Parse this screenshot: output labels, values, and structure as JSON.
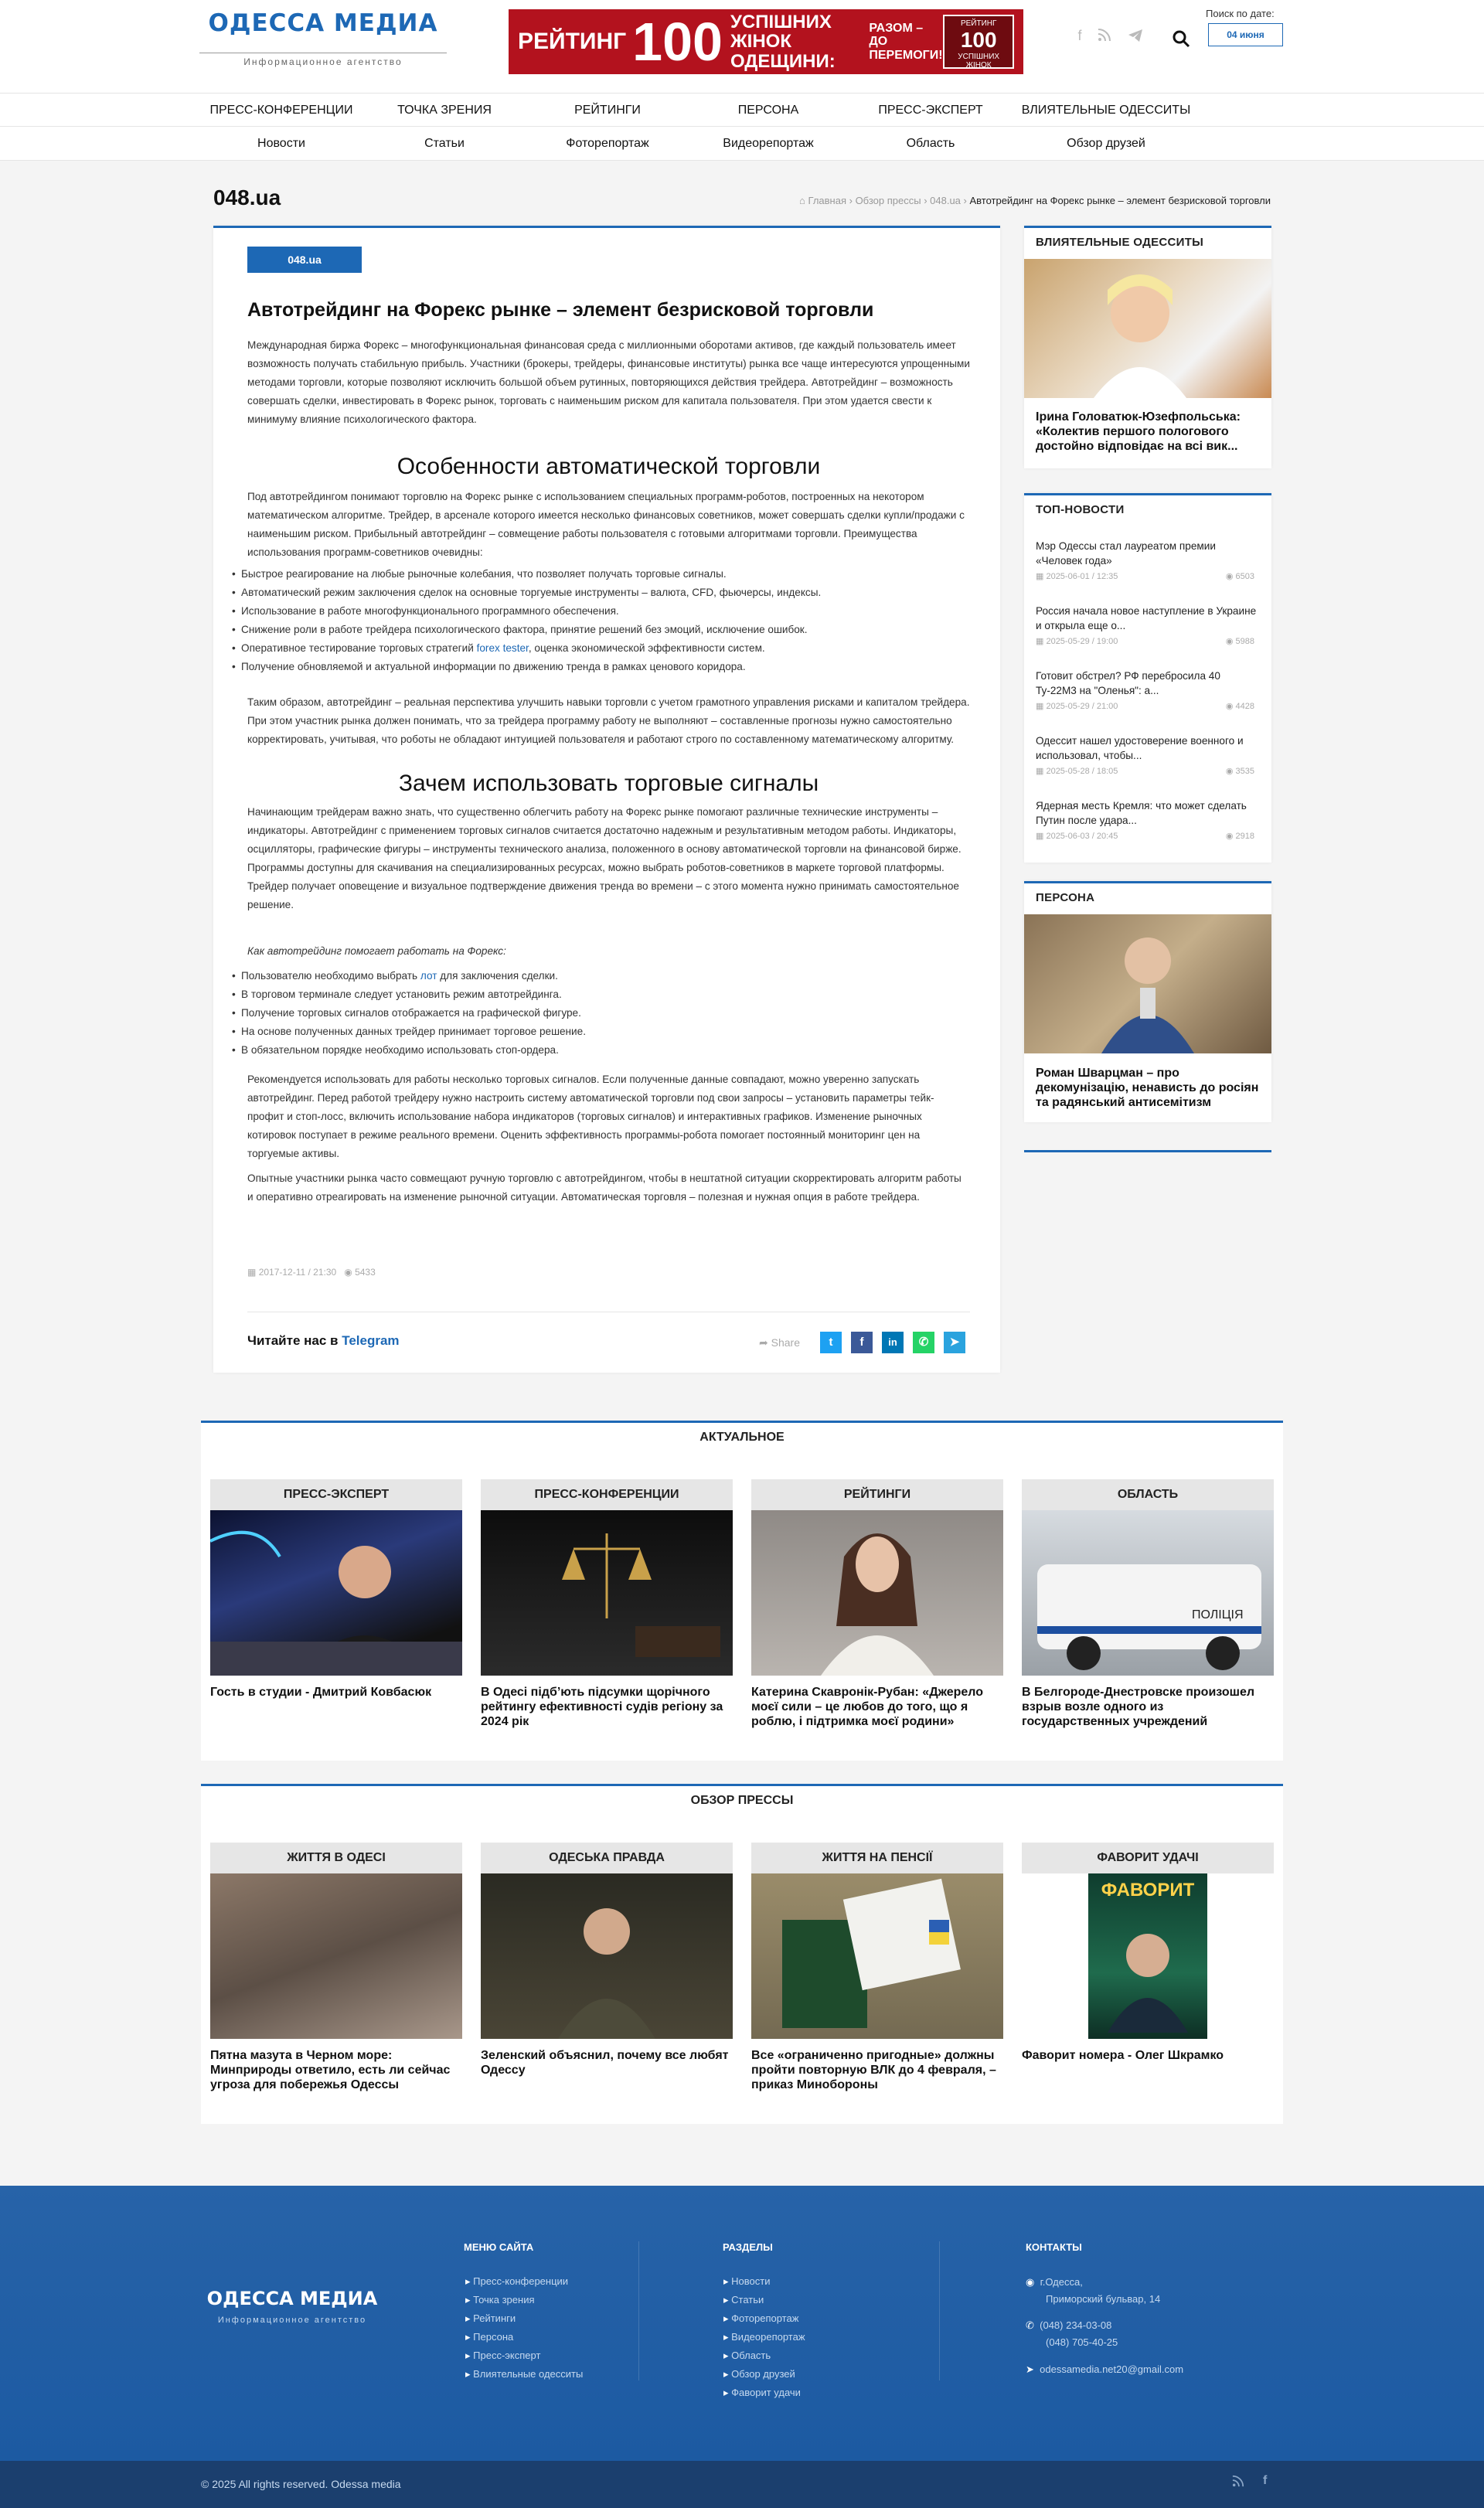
{
  "header": {
    "logo_name": "ОДЕССА МЕДИА",
    "logo_sub": "Информационное агентство",
    "banner": {
      "w1": "РЕЙТИНГ",
      "w2": "100",
      "w3": "УСПІШНИХ ЖІНОК ОДЕЩИНИ:",
      "w4": "РАЗОМ – ДО ПЕРЕМОГИ!",
      "badge_top": "РЕЙТИНГ",
      "badge_num": "100",
      "badge_bottom": "УСПІШНИХ ЖІНОК"
    },
    "date_label": "Поиск по дате:",
    "date_value": "04 июня"
  },
  "nav_main": [
    "ПРЕСС-КОНФЕРЕНЦИИ",
    "ТОЧКА ЗРЕНИЯ",
    "РЕЙТИНГИ",
    "ПЕРСОНА",
    "ПРЕСС-ЭКСПЕРТ",
    "ВЛИЯТЕЛЬНЫЕ ОДЕССИТЫ"
  ],
  "nav_sub": [
    "Новости",
    "Статьи",
    "Фоторепортаж",
    "Видеорепортаж",
    "Область",
    "Обзор друзей"
  ],
  "page_heading": "048.ua",
  "breadcrumb": {
    "home": "Главная",
    "b1": "Обзор прессы",
    "b2": "048.ua",
    "current": "Автотрейдинг на Форекс рынке – элемент безрисковой торговли"
  },
  "article": {
    "badge": "048.ua",
    "title": "Автотрейдинг на Форекс рынке – элемент безрисковой торговли",
    "p1": "Международная биржа Форекс – многофункциональная финансовая среда с миллионными оборотами активов, где каждый пользователь имеет возможность получать стабильную прибыль. Участники (брокеры, трейдеры, финансовые институты) рынка все чаще интересуются упрощенными методами торговли, которые позволяют исключить большой объем рутинных, повторяющихся действия трейдера. Автотрейдинг – возможность совершать сделки, инвестировать в Форекс рынок, торговать с наименьшим риском для капитала пользователя. При этом удается свести к минимуму влияние психологического фактора.",
    "h2a": "Особенности автоматической торговли",
    "p2": "Под автотрейдингом понимают торговлю на Форекс рынке с использованием специальных программ-роботов, построенных на некотором математическом алгоритме. Трейдер, в арсенале которого имеется несколько финансовых советников, может совершать сделки купли/продажи с наименьшим риском. Прибыльный автотрейдинг – совмещение работы пользователя с готовыми алгоритмами торговли. Преимущества использования программ-советников очевидны:",
    "list1": [
      "Быстрое реагирование на любые рыночные колебания, что позволяет получать торговые сигналы.",
      "Автоматический режим заключения сделок на основные торгуемые инструменты – валюта, CFD, фьючерсы, индексы.",
      "Использование в работе многофункционального программного обеспечения.",
      "Снижение роли в работе трейдера психологического фактора, принятие решений без эмоций, исключение ошибок."
    ],
    "list1_5a": "Оперативное тестирование торговых стратегий ",
    "list1_5link": "forex tester",
    "list1_5b": ", оценка экономической эффективности систем.",
    "list1_6": "Получение обновляемой и актуальной информации по движению тренда в рамках ценового коридора.",
    "p3": "Таким образом, автотрейдинг – реальная перспектива улучшить навыки торговли с учетом грамотного управления рисками и капиталом трейдера. При этом участник рынка должен понимать, что за трейдера программу работу не выполняют – составленные прогнозы нужно самостоятельно корректировать, учитывая, что роботы не обладают интуицией пользователя и работают строго по составленному математическому алгоритму.",
    "h2b": "Зачем использовать торговые сигналы",
    "p4": "Начинающим трейдерам важно знать, что существенно облегчить работу на Форекс рынке помогают различные технические инструменты – индикаторы. Автотрейдинг с применением торговых сигналов считается достаточно надежным и результативным методом работы. Индикаторы, осцилляторы, графические фигуры – инструменты технического анализа, положенного в основу автоматической торговли на финансовой бирже. Программы доступны для скачивания на специализированных ресурсах, можно выбрать роботов-советников в маркете торговой платформы. Трейдер получает оповещение и визуальное подтверждение движения тренда во времени – с этого момента нужно принимать самостоятельное решение.",
    "p5": "Как автотрейдинг помогает работать на Форекс:",
    "list2_1a": "Пользователю необходимо выбрать ",
    "list2_1link": "лот",
    "list2_1b": " для заключения сделки.",
    "list2": [
      "В торговом терминале следует установить режим автотрейдинга.",
      "Получение торговых сигналов отображается на графической фигуре.",
      "На основе полученных данных трейдер принимает торговое решение.",
      "В обязательном порядке необходимо использовать стоп-ордера."
    ],
    "p6": "Рекомендуется использовать для работы несколько торговых сигналов. Если полученные данные совпадают, можно уверенно запускать автотрейдинг. Перед работой трейдеру нужно настроить систему автоматической торговли под свои запросы – установить параметры тейк-профит и стоп-лосс, включить использование набора индикаторов (торговых сигналов) и интерактивных графиков. Изменение рыночных котировок поступает в режиме реального времени. Оценить эффективность программы-робота помогает постоянный мониторинг цен на торгуемые активы.",
    "p7": "Опытные участники рынка часто совмещают ручную торговлю с автотрейдингом, чтобы в нештатной ситуации скорректировать алгоритм работы и оперативно отреагировать на изменение рыночной ситуации. Автоматическая торговля – полезная и нужная опция в работе трейдера.",
    "date": "2017-12-11 / 21:30",
    "views": "5433",
    "tg_prefix": "Читайте нас в ",
    "tg_name": "Telegram",
    "share": "Share"
  },
  "sidebar": {
    "influential": {
      "title": "ВЛИЯТЕЛЬНЫЕ ОДЕССИТЫ",
      "caption": "Ірина Головатюк-Юзефпольська: «Колектив першого пологового достойно відповідає на всі вик..."
    },
    "top": {
      "title": "ТОП-НОВОСТИ",
      "items": [
        {
          "t": "Мэр Одессы стал лауреатом премии «Человек года»",
          "d": "2025-06-01 / 12:35",
          "v": "6503"
        },
        {
          "t": "Россия начала новое наступление в Украине и открыла еще о...",
          "d": "2025-05-29 / 19:00",
          "v": "5988"
        },
        {
          "t": "Готовит обстрел? РФ перебросила 40 Ту-22М3 на \"Оленья\": а...",
          "d": "2025-05-29 / 21:00",
          "v": "4428"
        },
        {
          "t": "Одессит нашел удостоверение военного и использовал, чтобы...",
          "d": "2025-05-28 / 18:05",
          "v": "3535"
        },
        {
          "t": "Ядерная месть Кремля: что может сделать Путин после удара...",
          "d": "2025-06-03 / 20:45",
          "v": "2918"
        }
      ]
    },
    "persona": {
      "title": "ПЕРСОНА",
      "caption": "Роман Шварцман – про декомунізацію, ненависть до росіян та радянський антисемітизм"
    }
  },
  "actual": {
    "title": "АКТУАЛЬНОЕ",
    "cards": [
      {
        "cat": "ПРЕСС-ЭКСПЕРТ",
        "title": "Гость в студии - Дмитрий Ковбасюк"
      },
      {
        "cat": "ПРЕСС-КОНФЕРЕНЦИИ",
        "title": "В Одесі підбʼють підсумки щорічного рейтингу ефективності судів регіону за 2024 рік"
      },
      {
        "cat": "РЕЙТИНГИ",
        "title": "Катерина Скавронік-Рубан: «Джерело моєї сили – це любов до того, що я роблю, і підтримка моєї родини»"
      },
      {
        "cat": "ОБЛАСТЬ",
        "title": "В Белгороде-Днестровске произошел взрыв возле одного из государственных учреждений"
      }
    ]
  },
  "press": {
    "title": "ОБЗОР ПРЕССЫ",
    "cards": [
      {
        "cat": "ЖИТТЯ В ОДЕСІ",
        "title": "Пятна мазута в Черном море: Минприроды ответило, есть ли сейчас угроза для побережья Одессы"
      },
      {
        "cat": "ОДЕСЬКА ПРАВДА",
        "title": "Зеленский объяснил, почему все любят Одессу"
      },
      {
        "cat": "ЖИТТЯ НА ПЕНСІЇ",
        "title": "Все «ограниченно пригодные» должны пройти повторную ВЛК до 4 февраля, – приказ Минобороны"
      },
      {
        "cat": "ФАВОРИТ УДАЧІ",
        "title": "Фаворит номера - Олег Шкрамко"
      }
    ],
    "magazine": "ФАВОРИТ",
    "police": "ПОЛІЦІЯ"
  },
  "footer": {
    "menu_title": "МЕНЮ САЙТА",
    "menu": [
      "Пресс-конференции",
      "Точка зрения",
      "Рейтинги",
      "Персона",
      "Пресс-эксперт",
      "Влиятельные одесситы"
    ],
    "sections_title": "РАЗДЕЛЫ",
    "sections": [
      "Новости",
      "Статьи",
      "Фоторепортаж",
      "Видеорепортаж",
      "Область",
      "Обзор друзей",
      "Фаворит удачи"
    ],
    "contacts_title": "КОНТАКТЫ",
    "address1": "г.Одесса,",
    "address2": "Приморский бульвар, 14",
    "phone1": "(048) 234-03-08",
    "phone2": "(048) 705-40-25",
    "email": "odessamedia.net20@gmail.com",
    "copyright": "© 2025 All rights reserved. Odessa media"
  }
}
